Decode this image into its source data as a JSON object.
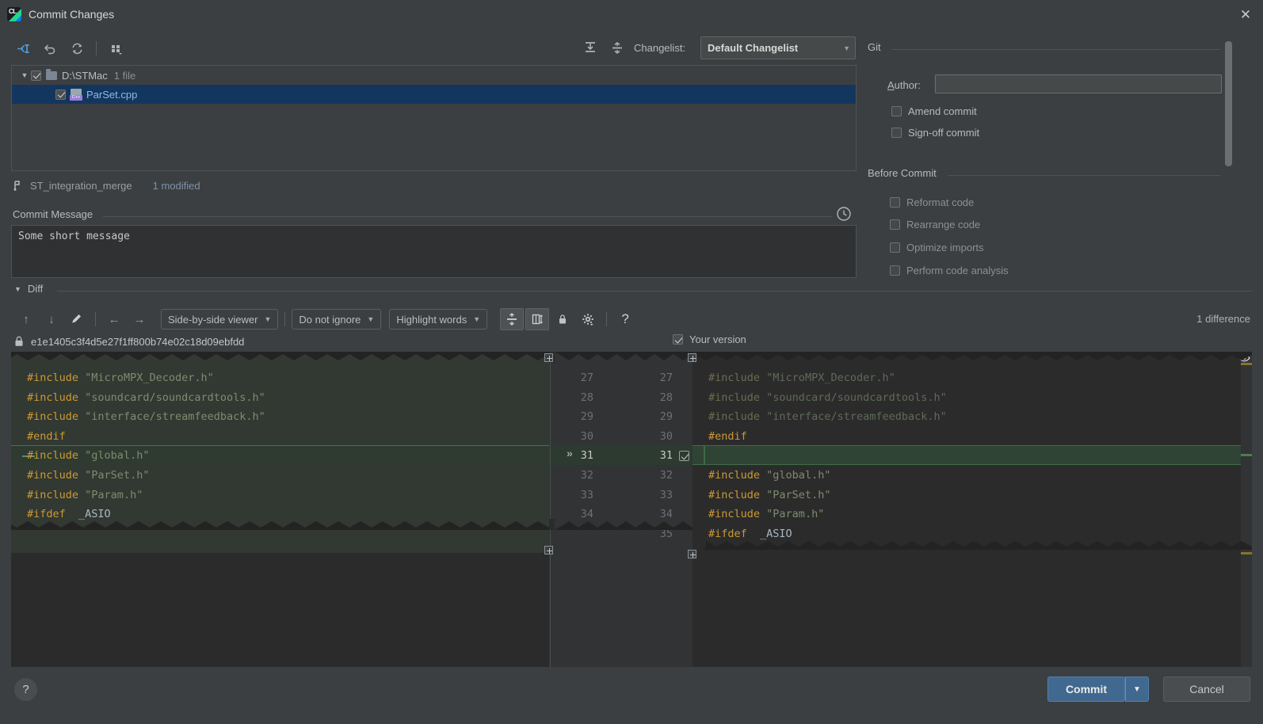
{
  "window": {
    "title": "Commit Changes",
    "app_icon": "clion-icon",
    "close_label": "✕"
  },
  "toolbar": {
    "buttons": [
      {
        "name": "show-diff-button",
        "glyph": "⇥"
      },
      {
        "name": "revert-button",
        "glyph": "↶"
      },
      {
        "name": "refresh-button",
        "glyph": "⟳"
      },
      {
        "name": "group-by-button",
        "glyph": "∷"
      }
    ],
    "expand_all": "expand-all-icon",
    "collapse_all": "collapse-all-icon",
    "changelist_label": "Changelist:",
    "changelist_value": "Default Changelist",
    "changelist_arrow": "▼"
  },
  "file_tree": {
    "root": {
      "triangle": "▼",
      "path": "D:\\STMac",
      "count": "1 file",
      "checked": true
    },
    "files": [
      {
        "name": "ParSet.cpp",
        "checked": true,
        "icon": "cpp-file-icon",
        "selected": true
      }
    ]
  },
  "branch_bar": {
    "icon": "branch-icon",
    "branch": "ST_integration_merge",
    "status": "1 modified"
  },
  "commit_message": {
    "legend": "Commit Message",
    "legend_mnemonic": "C",
    "value": "Some short message",
    "history_icon": "clock-icon"
  },
  "git_panel": {
    "legend": "Git",
    "author_label": "Author:",
    "author_mnemonic": "A",
    "author_value": "",
    "checkboxes": [
      {
        "label": "Amend commit",
        "mnemonic": "m",
        "checked": false,
        "dim": false,
        "name": "amend-commit-checkbox"
      },
      {
        "label": "Sign-off commit",
        "mnemonic": "g",
        "checked": false,
        "dim": false,
        "name": "sign-off-commit-checkbox"
      }
    ]
  },
  "before_commit": {
    "legend": "Before Commit",
    "checkboxes": [
      {
        "label": "Reformat code",
        "mnemonic": "R",
        "checked": false,
        "dim": true,
        "name": "reformat-code-checkbox"
      },
      {
        "label": "Rearrange code",
        "mnemonic": "n",
        "checked": false,
        "dim": true,
        "name": "rearrange-code-checkbox"
      },
      {
        "label": "Optimize imports",
        "mnemonic": "O",
        "checked": false,
        "dim": true,
        "name": "optimize-imports-checkbox"
      },
      {
        "label": "Perform code analysis",
        "mnemonic": "s",
        "checked": false,
        "dim": true,
        "name": "perform-code-analysis-checkbox"
      }
    ]
  },
  "diff": {
    "legend": "Diff",
    "legend_triangle": "▼",
    "difference_count": "1 difference",
    "toolbar": {
      "prev_diff": "↑",
      "next_diff": "↓",
      "edit": "✎",
      "apply_left": "←",
      "apply_right": "→",
      "viewer_mode": "Side-by-side viewer",
      "ignore_mode": "Do not ignore",
      "highlight_mode": "Highlight words",
      "collapse_unchanged": "collapse-unchanged-icon",
      "show_whitespace": "show-whitespace-icon",
      "read_only": "lock-icon",
      "settings": "gear-icon",
      "help": "?",
      "arrow": "▼"
    },
    "revision": {
      "icon": "lock-icon",
      "hash": "e1e1405c3f4d5e27f1ff800b74e02c18d09ebfdd"
    },
    "your_version": {
      "label": "Your version",
      "checked": true
    },
    "eye_icon": "eye-icon",
    "left_lines": [
      {
        "num": "27",
        "text": "#include \"MicroMPX_Decoder.h\"",
        "kw": "#include",
        "str": "\"MicroMPX_Decoder.h\""
      },
      {
        "num": "28",
        "text": "#include \"soundcard/soundcardtools.h\"",
        "kw": "#include",
        "str": "\"soundcard/soundcardtools.h\""
      },
      {
        "num": "29",
        "text": "#include \"interface/streamfeedback.h\"",
        "kw": "#include",
        "str": "\"interface/streamfeedback.h\""
      },
      {
        "num": "30",
        "text": "#endif",
        "kw": "#endif",
        "str": ""
      },
      {
        "num": "31",
        "text": "#include \"global.h\"",
        "kw": "#include",
        "str": "\"global.h\""
      },
      {
        "num": "32",
        "text": "#include \"ParSet.h\"",
        "kw": "#include",
        "str": "\"ParSet.h\""
      },
      {
        "num": "33",
        "text": "#include \"Param.h\"",
        "kw": "#include",
        "str": "\"Param.h\""
      },
      {
        "num": "34",
        "text": "#ifdef _ASIO",
        "kw": "#ifdef",
        "str": ""
      }
    ],
    "right_lines": [
      {
        "num": "27",
        "text": "#include \"MicroMPX_Decoder.h\"",
        "kw": "#include",
        "str": "\"MicroMPX_Decoder.h\""
      },
      {
        "num": "28",
        "text": "#include \"soundcard/soundcardtools.h\"",
        "kw": "#include",
        "str": "\"soundcard/soundcardtools.h\""
      },
      {
        "num": "29",
        "text": "#include \"interface/streamfeedback.h\"",
        "kw": "#include",
        "str": "\"interface/streamfeedback.h\""
      },
      {
        "num": "30",
        "text": "#endif",
        "kw": "#endif",
        "str": ""
      },
      {
        "num": "31",
        "text": "",
        "kw": "",
        "str": ""
      },
      {
        "num": "32",
        "text": "#include \"global.h\"",
        "kw": "#include",
        "str": "\"global.h\""
      },
      {
        "num": "33",
        "text": "#include \"ParSet.h\"",
        "kw": "#include",
        "str": "\"ParSet.h\""
      },
      {
        "num": "34",
        "text": "#include \"Param.h\"",
        "kw": "#include",
        "str": "\"Param.h\""
      },
      {
        "num": "35",
        "text": "#ifdef _ASIO",
        "kw": "#ifdef",
        "str": ""
      }
    ],
    "accept_chevron": "»",
    "accept_checkbox_checked": true,
    "colors": {
      "inserted": "#2f4434",
      "inserted_border": "#3e6b46",
      "marker_inserted": "#4f7b52",
      "marker_folded": "#8a7229",
      "keyword": "#cc9a34",
      "string": "#7d8c6f"
    }
  },
  "footer": {
    "help": "?",
    "commit_label": "Commit",
    "commit_mnemonic": "i",
    "commit_arrow": "▼",
    "cancel_label": "Cancel"
  }
}
